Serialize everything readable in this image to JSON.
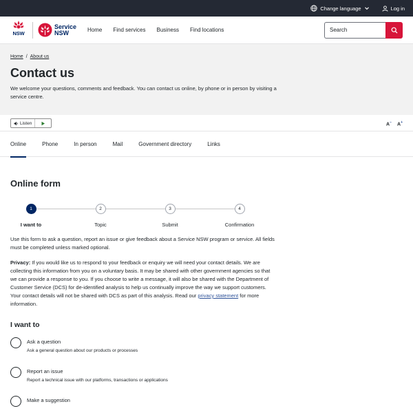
{
  "utility": {
    "language_label": "Change language",
    "login_label": "Log in"
  },
  "header": {
    "nsw_logo_text": "NSW",
    "service_logo_line1": "Service",
    "service_logo_line2": "NSW",
    "nav": [
      "Home",
      "Find services",
      "Business",
      "Find locations"
    ],
    "search_placeholder": "Search"
  },
  "hero": {
    "breadcrumb": [
      "Home",
      "About us"
    ],
    "breadcrumb_separator": "/",
    "title": "Contact us",
    "description": "We welcome your questions, comments and feedback. You can contact us online, by phone or in person by visiting a service centre."
  },
  "listen": {
    "label": "Listen",
    "font_decrease": "A",
    "font_decrease_sup": "−",
    "font_increase": "A",
    "font_increase_sup": "+"
  },
  "tabs": [
    {
      "label": "Online",
      "active": true
    },
    {
      "label": "Phone",
      "active": false
    },
    {
      "label": "In person",
      "active": false
    },
    {
      "label": "Mail",
      "active": false
    },
    {
      "label": "Government directory",
      "active": false
    },
    {
      "label": "Links",
      "active": false
    }
  ],
  "form": {
    "title": "Online form",
    "steps": [
      {
        "number": "1",
        "label": "I want to",
        "active": true
      },
      {
        "number": "2",
        "label": "Topic",
        "active": false
      },
      {
        "number": "3",
        "label": "Submit",
        "active": false
      },
      {
        "number": "4",
        "label": "Confirmation",
        "active": false
      }
    ],
    "intro": "Use this form to ask a question, report an issue or give feedback about a Service NSW program or service. All fields must be completed unless marked optional.",
    "privacy_label": "Privacy:",
    "privacy_text": " If you would like us to respond to your feedback or enquiry we will need your contact details. We are collecting this information from you on a voluntary basis. It may be shared with other government agencies so that we can provide a response to you. If you choose to write a message, it will also be shared with the Department of Customer Service (DCS) for de-identified analysis to help us continually improve the way we support customers. Your contact details will not be shared with DCS as part of this analysis. Read our ",
    "privacy_link": "privacy statement",
    "privacy_after": " for more information.",
    "question": "I want to",
    "options": [
      {
        "title": "Ask a question",
        "description": "Ask a general question about our products or processes"
      },
      {
        "title": "Report an issue",
        "description": "Report a technical issue with our platforms, transactions or applications"
      },
      {
        "title": "Make a suggestion",
        "description": ""
      }
    ]
  },
  "colors": {
    "navy": "#002664",
    "red": "#d7153a",
    "utility_bar": "#242934",
    "hero_bg": "#f2f2f2"
  }
}
